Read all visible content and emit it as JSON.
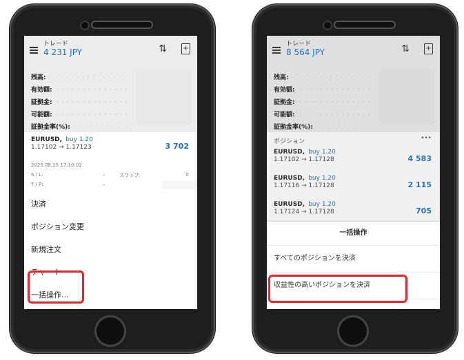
{
  "phone1": {
    "header": {
      "title": "トレード",
      "balance": "4 231 JPY",
      "sort_icon": "sort-arrows-icon",
      "add_icon": "new-order-icon"
    },
    "summary": {
      "labels": [
        "残高:",
        "有効額:",
        "証拠金:",
        "可能額:",
        "証拠金率(%):"
      ]
    },
    "position": {
      "symbol": "EURUSD,",
      "direction": "buy 1.20",
      "prices": "1.17102 → 1.17123",
      "profit": "3 702"
    },
    "detail": {
      "time": "2025.08.15 17:10:02",
      "sl_label": "S / L:",
      "sl_value": "–",
      "swap_label": "スワップ:",
      "swap_value": "0",
      "tp_label": "T / P:",
      "tp_value": "–"
    },
    "menu": [
      "決済",
      "ポジション変更",
      "新規注文",
      "チャート",
      "一括操作..."
    ]
  },
  "phone2": {
    "header": {
      "title": "トレード",
      "balance": "8 564 JPY"
    },
    "summary": {
      "labels": [
        "残高:",
        "有効額:",
        "証拠金:",
        "可能額:",
        "証拠金率(%):"
      ]
    },
    "positions_title": "ポジション",
    "more": "•••",
    "positions": [
      {
        "symbol": "EURUSD,",
        "direction": "buy 1.20",
        "prices": "1.17102 → 1.17128",
        "profit": "4 583"
      },
      {
        "symbol": "EURUSD,",
        "direction": "buy 1.20",
        "prices": "1.17116 → 1.17128",
        "profit": "2 115"
      },
      {
        "symbol": "EURUSD,",
        "direction": "buy 1.20",
        "prices": "1.17124 → 1.17128",
        "profit": "705"
      }
    ],
    "sheet": {
      "title": "一括操作",
      "items": [
        "すべてのポジションを決済",
        "収益性の高いポジションを決済"
      ]
    }
  },
  "colors": {
    "accent": "#1e6fc4",
    "highlight": "#e8252b"
  }
}
